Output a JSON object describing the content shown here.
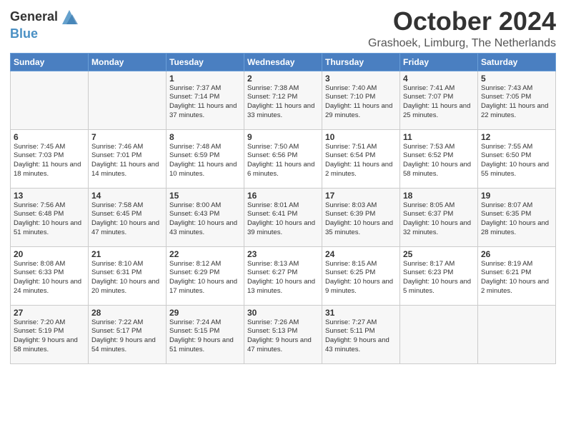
{
  "header": {
    "logo_line1": "General",
    "logo_line2": "Blue",
    "month": "October 2024",
    "location": "Grashoek, Limburg, The Netherlands"
  },
  "weekdays": [
    "Sunday",
    "Monday",
    "Tuesday",
    "Wednesday",
    "Thursday",
    "Friday",
    "Saturday"
  ],
  "rows": [
    [
      {
        "day": "",
        "info": ""
      },
      {
        "day": "",
        "info": ""
      },
      {
        "day": "1",
        "info": "Sunrise: 7:37 AM\nSunset: 7:14 PM\nDaylight: 11 hours and 37 minutes."
      },
      {
        "day": "2",
        "info": "Sunrise: 7:38 AM\nSunset: 7:12 PM\nDaylight: 11 hours and 33 minutes."
      },
      {
        "day": "3",
        "info": "Sunrise: 7:40 AM\nSunset: 7:10 PM\nDaylight: 11 hours and 29 minutes."
      },
      {
        "day": "4",
        "info": "Sunrise: 7:41 AM\nSunset: 7:07 PM\nDaylight: 11 hours and 25 minutes."
      },
      {
        "day": "5",
        "info": "Sunrise: 7:43 AM\nSunset: 7:05 PM\nDaylight: 11 hours and 22 minutes."
      }
    ],
    [
      {
        "day": "6",
        "info": "Sunrise: 7:45 AM\nSunset: 7:03 PM\nDaylight: 11 hours and 18 minutes."
      },
      {
        "day": "7",
        "info": "Sunrise: 7:46 AM\nSunset: 7:01 PM\nDaylight: 11 hours and 14 minutes."
      },
      {
        "day": "8",
        "info": "Sunrise: 7:48 AM\nSunset: 6:59 PM\nDaylight: 11 hours and 10 minutes."
      },
      {
        "day": "9",
        "info": "Sunrise: 7:50 AM\nSunset: 6:56 PM\nDaylight: 11 hours and 6 minutes."
      },
      {
        "day": "10",
        "info": "Sunrise: 7:51 AM\nSunset: 6:54 PM\nDaylight: 11 hours and 2 minutes."
      },
      {
        "day": "11",
        "info": "Sunrise: 7:53 AM\nSunset: 6:52 PM\nDaylight: 10 hours and 58 minutes."
      },
      {
        "day": "12",
        "info": "Sunrise: 7:55 AM\nSunset: 6:50 PM\nDaylight: 10 hours and 55 minutes."
      }
    ],
    [
      {
        "day": "13",
        "info": "Sunrise: 7:56 AM\nSunset: 6:48 PM\nDaylight: 10 hours and 51 minutes."
      },
      {
        "day": "14",
        "info": "Sunrise: 7:58 AM\nSunset: 6:45 PM\nDaylight: 10 hours and 47 minutes."
      },
      {
        "day": "15",
        "info": "Sunrise: 8:00 AM\nSunset: 6:43 PM\nDaylight: 10 hours and 43 minutes."
      },
      {
        "day": "16",
        "info": "Sunrise: 8:01 AM\nSunset: 6:41 PM\nDaylight: 10 hours and 39 minutes."
      },
      {
        "day": "17",
        "info": "Sunrise: 8:03 AM\nSunset: 6:39 PM\nDaylight: 10 hours and 35 minutes."
      },
      {
        "day": "18",
        "info": "Sunrise: 8:05 AM\nSunset: 6:37 PM\nDaylight: 10 hours and 32 minutes."
      },
      {
        "day": "19",
        "info": "Sunrise: 8:07 AM\nSunset: 6:35 PM\nDaylight: 10 hours and 28 minutes."
      }
    ],
    [
      {
        "day": "20",
        "info": "Sunrise: 8:08 AM\nSunset: 6:33 PM\nDaylight: 10 hours and 24 minutes."
      },
      {
        "day": "21",
        "info": "Sunrise: 8:10 AM\nSunset: 6:31 PM\nDaylight: 10 hours and 20 minutes."
      },
      {
        "day": "22",
        "info": "Sunrise: 8:12 AM\nSunset: 6:29 PM\nDaylight: 10 hours and 17 minutes."
      },
      {
        "day": "23",
        "info": "Sunrise: 8:13 AM\nSunset: 6:27 PM\nDaylight: 10 hours and 13 minutes."
      },
      {
        "day": "24",
        "info": "Sunrise: 8:15 AM\nSunset: 6:25 PM\nDaylight: 10 hours and 9 minutes."
      },
      {
        "day": "25",
        "info": "Sunrise: 8:17 AM\nSunset: 6:23 PM\nDaylight: 10 hours and 5 minutes."
      },
      {
        "day": "26",
        "info": "Sunrise: 8:19 AM\nSunset: 6:21 PM\nDaylight: 10 hours and 2 minutes."
      }
    ],
    [
      {
        "day": "27",
        "info": "Sunrise: 7:20 AM\nSunset: 5:19 PM\nDaylight: 9 hours and 58 minutes."
      },
      {
        "day": "28",
        "info": "Sunrise: 7:22 AM\nSunset: 5:17 PM\nDaylight: 9 hours and 54 minutes."
      },
      {
        "day": "29",
        "info": "Sunrise: 7:24 AM\nSunset: 5:15 PM\nDaylight: 9 hours and 51 minutes."
      },
      {
        "day": "30",
        "info": "Sunrise: 7:26 AM\nSunset: 5:13 PM\nDaylight: 9 hours and 47 minutes."
      },
      {
        "day": "31",
        "info": "Sunrise: 7:27 AM\nSunset: 5:11 PM\nDaylight: 9 hours and 43 minutes."
      },
      {
        "day": "",
        "info": ""
      },
      {
        "day": "",
        "info": ""
      }
    ]
  ]
}
